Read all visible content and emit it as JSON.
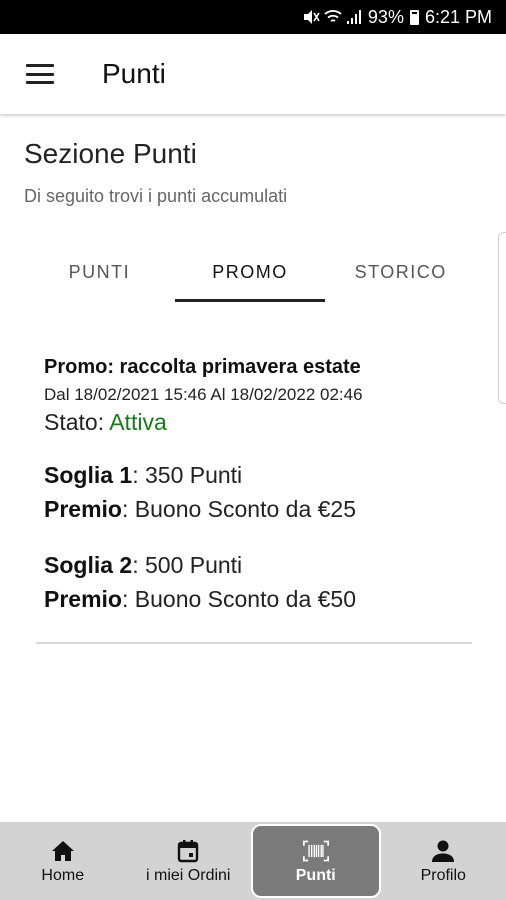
{
  "status_bar": {
    "battery": "93%",
    "time": "6:21 PM"
  },
  "app_bar": {
    "title": "Punti"
  },
  "section": {
    "title": "Sezione Punti",
    "subtitle": "Di seguito trovi i punti accumulati"
  },
  "tabs": [
    {
      "label": "PUNTI",
      "active": false
    },
    {
      "label": "PROMO",
      "active": true
    },
    {
      "label": "STORICO",
      "active": false
    }
  ],
  "promo": {
    "title": "Promo: raccolta primavera estate",
    "dates": "Dal 18/02/2021 15:46 Al 18/02/2022 02:46",
    "state_label": "Stato: ",
    "state_value": "Attiva",
    "state_color": "#1a7a1a",
    "thresholds": [
      {
        "label": "Soglia 1",
        "value": ": 350 Punti",
        "prize_label": "Premio",
        "prize_value": ": Buono Sconto da €25"
      },
      {
        "label": "Soglia 2",
        "value": ": 500 Punti",
        "prize_label": "Premio",
        "prize_value": ": Buono Sconto da €50"
      }
    ]
  },
  "bottom_nav": [
    {
      "label": "Home",
      "icon": "home-icon",
      "active": false
    },
    {
      "label": "i miei Ordini",
      "icon": "calendar-icon",
      "active": false
    },
    {
      "label": "Punti",
      "icon": "barcode-icon",
      "active": true
    },
    {
      "label": "Profilo",
      "icon": "person-icon",
      "active": false
    }
  ]
}
